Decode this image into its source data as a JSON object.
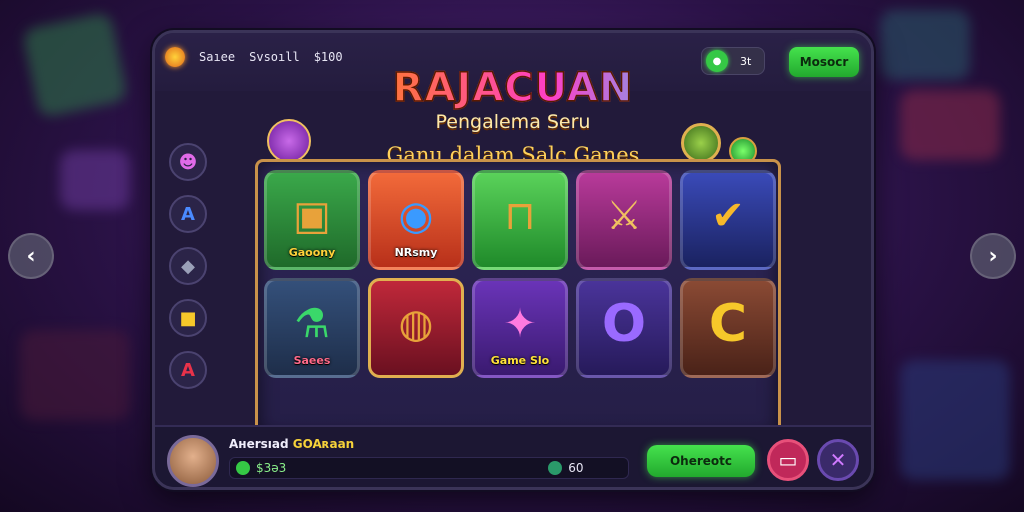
{
  "header": {
    "stat1": "Saıee",
    "stat2": "Svsoıll",
    "stat3": "$100",
    "toggle_value": "3t",
    "top_button": "Mosocr"
  },
  "title": {
    "main": "RAJACUAN",
    "subtitle": "Pengalema Seru",
    "tagline": "Ganu dalam Salc Ganes"
  },
  "sidebar": {
    "items": [
      {
        "icon": "character-icon",
        "glyph": "☻"
      },
      {
        "icon": "letter-a-icon",
        "glyph": "A"
      },
      {
        "icon": "gem-icon",
        "glyph": "◆"
      },
      {
        "icon": "ticket-icon",
        "glyph": "■"
      },
      {
        "icon": "alert-icon",
        "glyph": "A"
      }
    ]
  },
  "tiles": [
    {
      "label": "Gaoony",
      "icon": "treasure-chest-icon",
      "glyph": "▣",
      "bg": "#2f8a3a"
    },
    {
      "label": "NRsmy",
      "icon": "key-icon",
      "glyph": "◉",
      "bg": "#e2542a"
    },
    {
      "label": "",
      "icon": "hammer-icon",
      "glyph": "⊓",
      "bg": "#3cb84a"
    },
    {
      "label": "",
      "icon": "sword-icon",
      "glyph": "⚔",
      "bg": "#a02a86"
    },
    {
      "label": "",
      "icon": "arrow-check-icon",
      "glyph": "✔",
      "bg": "#2a3c9a"
    },
    {
      "label": "Saees",
      "icon": "potion-icon",
      "glyph": "⚗",
      "bg": "#2b3f6a"
    },
    {
      "label": "",
      "icon": "barrel-icon",
      "glyph": "◍",
      "bg": "#a52034"
    },
    {
      "label": "Game Slo",
      "icon": "wand-icon",
      "glyph": "✦",
      "bg": "#5b2aa0"
    },
    {
      "label": "",
      "icon": "letter-o-icon",
      "glyph": "O",
      "bg": "#3d2a7a"
    },
    {
      "label": "",
      "icon": "letter-c-icon",
      "glyph": "C",
      "bg": "#7a3a2a"
    }
  ],
  "footer": {
    "player_name": "Aнersıad",
    "player_highlight": "GOAʀaan",
    "balance_left": "$3ə3",
    "balance_right": "60",
    "action_button": "Ohereotc",
    "icon_left": "menu-icon",
    "icon_right": "close-icon"
  },
  "colors": {
    "accent_green": "#35c845",
    "frame_gold": "#c9924a",
    "background": "#2a1246"
  }
}
